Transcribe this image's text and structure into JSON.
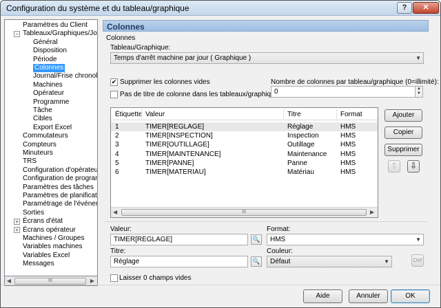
{
  "window": {
    "title": "Configuration du système et du tableau/graphique",
    "help_label": "?",
    "close_label": "✕"
  },
  "tree": {
    "items": [
      {
        "label": "Paramètres du Client",
        "indent": 0,
        "expander": ""
      },
      {
        "label": "Tableaux/Graphiques/Journa",
        "indent": 0,
        "expander": "−"
      },
      {
        "label": "Général",
        "indent": 1,
        "expander": ""
      },
      {
        "label": "Disposition",
        "indent": 1,
        "expander": ""
      },
      {
        "label": "Période",
        "indent": 1,
        "expander": ""
      },
      {
        "label": "Colonnes",
        "indent": 1,
        "expander": "",
        "selected": true
      },
      {
        "label": "Journal/Frise chronologic",
        "indent": 1,
        "expander": ""
      },
      {
        "label": "Machines",
        "indent": 1,
        "expander": ""
      },
      {
        "label": "Opérateur",
        "indent": 1,
        "expander": ""
      },
      {
        "label": "Programme",
        "indent": 1,
        "expander": ""
      },
      {
        "label": "Tâche",
        "indent": 1,
        "expander": ""
      },
      {
        "label": "Cibles",
        "indent": 1,
        "expander": ""
      },
      {
        "label": "Export Excel",
        "indent": 1,
        "expander": ""
      },
      {
        "label": "Commutateurs",
        "indent": 0,
        "expander": ""
      },
      {
        "label": "Compteurs",
        "indent": 0,
        "expander": ""
      },
      {
        "label": "Minuteurs",
        "indent": 0,
        "expander": ""
      },
      {
        "label": "TRS",
        "indent": 0,
        "expander": ""
      },
      {
        "label": "Configuration d'opérateur",
        "indent": 0,
        "expander": ""
      },
      {
        "label": "Configuration de programme",
        "indent": 0,
        "expander": ""
      },
      {
        "label": "Paramètres des tâches",
        "indent": 0,
        "expander": ""
      },
      {
        "label": "Paramètres de planification",
        "indent": 0,
        "expander": ""
      },
      {
        "label": "Paramétrage de l'événement",
        "indent": 0,
        "expander": ""
      },
      {
        "label": "Sorties",
        "indent": 0,
        "expander": ""
      },
      {
        "label": "Écrans d'état",
        "indent": 0,
        "expander": "+"
      },
      {
        "label": "Écrans opérateur",
        "indent": 0,
        "expander": "+"
      },
      {
        "label": "Machines / Groupes",
        "indent": 0,
        "expander": ""
      },
      {
        "label": "Variables machines",
        "indent": 0,
        "expander": ""
      },
      {
        "label": "Variables Excel",
        "indent": 0,
        "expander": ""
      },
      {
        "label": "Messages",
        "indent": 0,
        "expander": ""
      }
    ],
    "scroll_left": "◀",
    "scroll_right": "▶",
    "scroll_grip": "III"
  },
  "panel": {
    "header": "Colonnes",
    "group_label": "Colonnes",
    "table_label": "Tableau/Graphique:",
    "table_value": "Temps d'arrêt machine par jour  ( Graphique )",
    "suppress_empty": {
      "label": "Supprimer les colonnes vides",
      "checked": true
    },
    "no_title": {
      "label": "Pas de titre de colonne dans les tableaux/graphiques",
      "checked": false
    },
    "col_count_label": "Nombre de colonnes par tableau/graphique (0=illimité):",
    "col_count_value": "0"
  },
  "grid": {
    "headers": [
      "Étiquette",
      "Valeur",
      "Titre",
      "Format"
    ],
    "rows": [
      {
        "label": "1",
        "value": "TIMER[REGLAGE]",
        "title": "Réglage",
        "format": "HMS"
      },
      {
        "label": "2",
        "value": "TIMER[INSPECTION]",
        "title": "Inspection",
        "format": "HMS"
      },
      {
        "label": "3",
        "value": "TIMER[OUTILLAGE]",
        "title": "Outillage",
        "format": "HMS"
      },
      {
        "label": "4",
        "value": "TIMER[MAINTENANCE]",
        "title": "Maintenance",
        "format": "HMS"
      },
      {
        "label": "5",
        "value": "TIMER[PANNE]",
        "title": "Panne",
        "format": "HMS"
      },
      {
        "label": "6",
        "value": "TIMER[MATERIAU]",
        "title": "Matériau",
        "format": "HMS"
      }
    ],
    "scroll_grip": "III"
  },
  "side_buttons": {
    "add": "Ajouter",
    "copy": "Copier",
    "delete": "Supprimer",
    "up": "⇧",
    "down": "⇩"
  },
  "editor": {
    "value_label": "Valeur:",
    "value": "TIMER[REGLAGE]",
    "title_label": "Titre:",
    "title": "Réglage",
    "format_label": "Format:",
    "format": "HMS",
    "color_label": "Couleur:",
    "color": "Défaut",
    "def_button": "Déf",
    "show_zero": {
      "label": "Laisser 0 champs vides",
      "checked": false
    }
  },
  "footer": {
    "help": "Aide",
    "cancel": "Annuler",
    "ok": "OK"
  },
  "icons": {
    "pick": "🔍",
    "dropdown": "▼",
    "check": "✔"
  }
}
